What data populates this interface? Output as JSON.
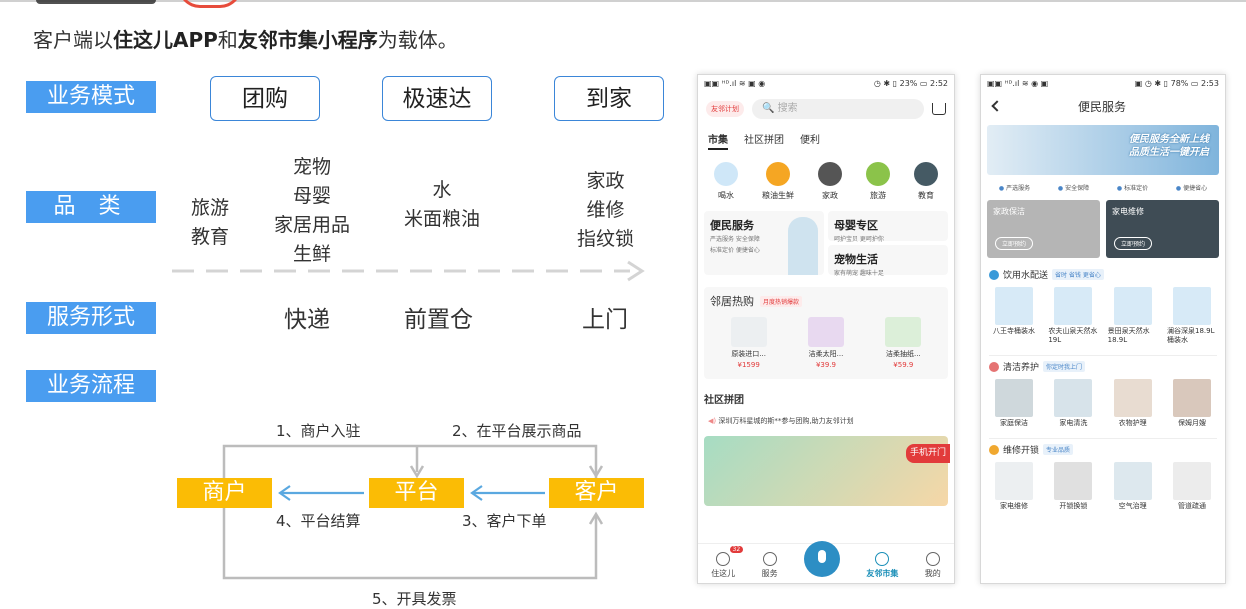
{
  "subtitle": {
    "prefix": "客户端以",
    "app": "住这儿APP",
    "and": "和",
    "mini": "友邻市集小程序",
    "suffix": "为载体。"
  },
  "tags": {
    "business_mode": "业务模式",
    "category": "品 类",
    "service_form": "服务形式",
    "business_flow": "业务流程"
  },
  "modes": [
    "团购",
    "极速达",
    "到家"
  ],
  "categories": {
    "col1": [
      "旅游",
      "教育"
    ],
    "col2": [
      "宠物",
      "母婴",
      "家居用品",
      "生鲜"
    ],
    "col3": [
      "水",
      "米面粮油"
    ],
    "col4": [
      "家政",
      "维修",
      "指纹锁"
    ]
  },
  "service_forms": [
    "快递",
    "前置仓",
    "上门"
  ],
  "flow": {
    "merchant": "商户",
    "platform": "平台",
    "customer": "客户",
    "step1": "1、商户入驻",
    "step2": "2、在平台展示商品",
    "step3": "3、客户下单",
    "step4": "4、平台结算",
    "step5": "5、开具发票"
  },
  "phone1": {
    "status_left": "▣▣ ᴴᴰ.ıl ≋ ▣ ◉",
    "status_right": "◷ ✱ ▯ 23% ▭ 2:52",
    "logo": "友邻计划",
    "search_placeholder": "搜索",
    "tabs": [
      "市集",
      "社区拼团",
      "便利"
    ],
    "cats": [
      "喝水",
      "粮油生鲜",
      "家政",
      "旅游",
      "教育"
    ],
    "promo1_title": "便民服务",
    "promo1_sub1": "严选服务 安全保障",
    "promo1_sub2": "标准定价 便捷省心",
    "promo2_title": "母婴专区",
    "promo2_sub": "呵护宝贝 更呵护你",
    "promo3_title": "宠物生活",
    "promo3_sub": "家有萌宠 趣味十足",
    "hot_title": "邻居热购",
    "hot_badge": "月度热销爆款",
    "hot_items": [
      {
        "name": "原装进口...",
        "price": "¥1599"
      },
      {
        "name": "洁柔太阳...",
        "price": "¥39.9"
      },
      {
        "name": "洁柔抽纸...",
        "price": "¥59.9"
      }
    ],
    "community_title": "社区拼团",
    "notice": "深圳万科星城的斯**参与团购,助力友邻计划",
    "banner_btn": "手机开门",
    "nav": [
      "住这儿",
      "服务",
      "友邻市集",
      "我的"
    ],
    "nav_badge": "32"
  },
  "phone2": {
    "status_left": "▣▣ ᴴᴰ.ıl ≋ ◉ ▣",
    "status_right": "▣ ◷ ✱ ▯ 78% ▭ 2:53",
    "title": "便民服务",
    "hero_line1": "便民服务全新上线",
    "hero_line2": "品质生活一键开启",
    "perks": [
      "严选服务",
      "安全保障",
      "标准定价",
      "便捷省心"
    ],
    "card1_title": "家政保洁",
    "card1_btn": "立即预约",
    "card2_title": "家电维修",
    "card2_btn": "立即预约",
    "sec1_title": "饮用水配送",
    "sec1_tag": "省时 省钱 更省心",
    "sec1_items": [
      "八王寺桶装水",
      "农夫山泉天然水19L",
      "景田泉天然水18.9L",
      "澜谷深泉18.9L桶装水"
    ],
    "sec2_title": "清洁养护",
    "sec2_tag": "你定时我上门",
    "sec2_items": [
      "家庭保洁",
      "家电清洗",
      "衣物护理",
      "保姆月嫂"
    ],
    "sec3_title": "维修开锁",
    "sec3_tag": "专业品质",
    "sec3_items": [
      "家电维修",
      "开锁换锁",
      "空气治理",
      "管道疏通"
    ]
  }
}
